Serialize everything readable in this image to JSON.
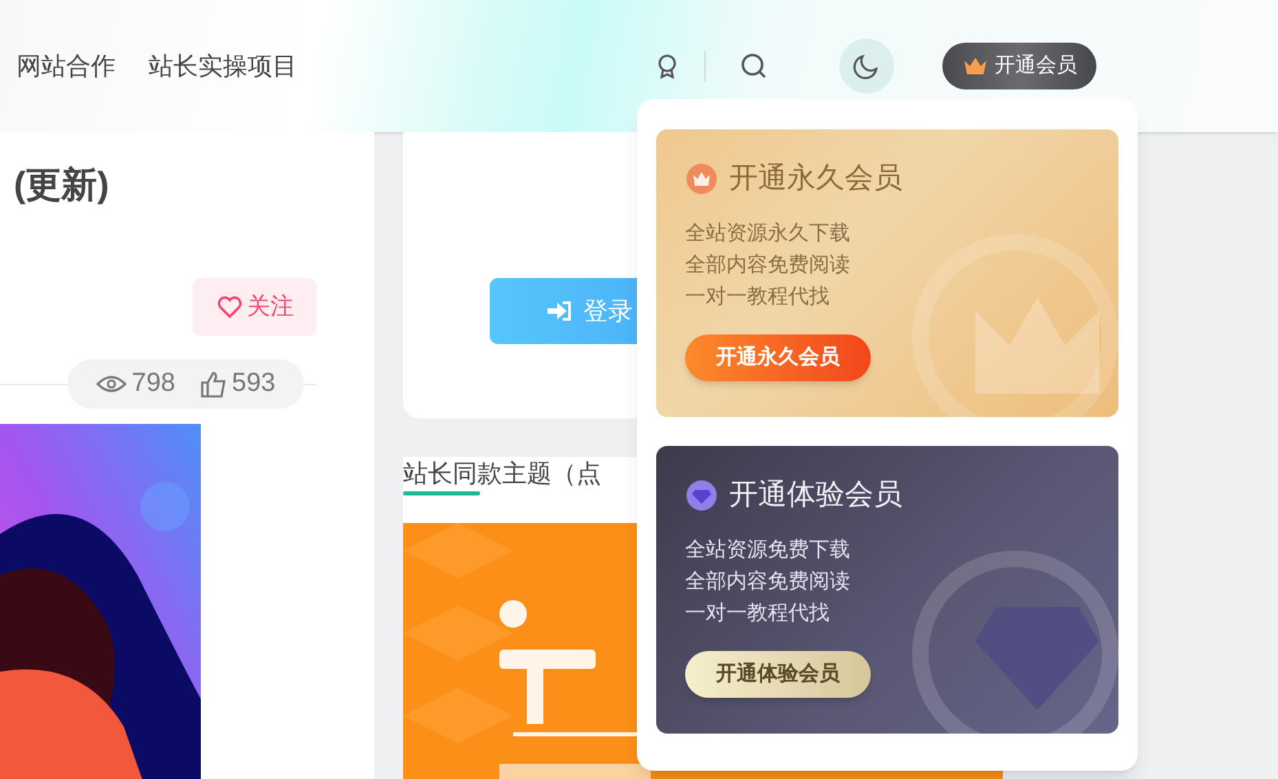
{
  "nav": [
    {
      "label": "网站合作"
    },
    {
      "label": "站长实操项目"
    }
  ],
  "vip_button": "开通会员",
  "article": {
    "title": "(更新)",
    "follow_button": "关注",
    "views": "798",
    "likes": "593"
  },
  "login_card": {
    "login_button": "登录"
  },
  "section": {
    "title": "站长同款主题（点"
  },
  "vip_menu": {
    "plans": [
      {
        "kind": "permanent",
        "title": "开通永久会员",
        "features": [
          "全站资源永久下载",
          "全部内容免费阅读",
          "一对一教程代找"
        ],
        "button": "开通永久会员"
      },
      {
        "kind": "trial",
        "title": "开通体验会员",
        "features": [
          "全站资源免费下载",
          "全部内容免费阅读",
          "一对一教程代找"
        ],
        "button": "开通体验会员"
      }
    ]
  }
}
